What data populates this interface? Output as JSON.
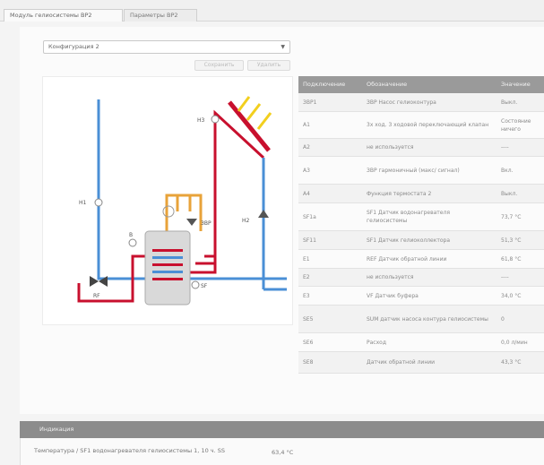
{
  "tabs": [
    {
      "label": "Модуль гелиосистемы BP2"
    },
    {
      "label": "Параметры BP2"
    }
  ],
  "config_select": {
    "value": "Конфигурация 2"
  },
  "buttons": {
    "save": "Сохранить",
    "delete": "Удалить"
  },
  "diagram": {
    "labels": {
      "h3": "H3",
      "h1": "H1",
      "b": "В",
      "h2": "H2",
      "sp": "ЗВР",
      "sf": "SF",
      "rf": "RF"
    },
    "colors": {
      "hot": "#c8102e",
      "cold": "#4a8fd6",
      "dhw": "#e8a33a",
      "sun": "#f2cf1e",
      "tank": "#d9d9d9"
    }
  },
  "table": {
    "headers": [
      "Подключение",
      "Обозначение",
      "Значение"
    ],
    "rows": [
      {
        "port": "ЗВР1",
        "name": "ЗВР Насос гелиоконтура",
        "value": "Выкл."
      },
      {
        "port": "A1",
        "name": "3х ход. 3 ходовой переключающий клапан",
        "value": "Состояние ничего"
      },
      {
        "port": "A2",
        "name": "не используется",
        "value": "----"
      },
      {
        "port": "A3",
        "name": "ЗВР гармоничный (макс/ сигнал)",
        "value": "Вкл."
      },
      {
        "port": "A4",
        "name": "Функция термостата 2",
        "value": "Выкл."
      },
      {
        "port": "SF1a",
        "name": "SF1 Датчик водонагревателя гелиосистемы",
        "value": "73,7 °C"
      },
      {
        "port": "SF11",
        "name": "SF1 Датчик гелиоколлектора",
        "value": "51,3 °C"
      },
      {
        "port": "E1",
        "name": "REF Датчик обратной линии",
        "value": "61,8 °C"
      },
      {
        "port": "E2",
        "name": "не используется",
        "value": "----"
      },
      {
        "port": "E3",
        "name": "VF Датчик буфера",
        "value": "34,0 °C"
      },
      {
        "port": "SE5",
        "name": "SUM датчик насоса контура гелиосистемы",
        "value": "0"
      },
      {
        "port": "SE6",
        "name": "Расход",
        "value": "0,0 л/мин"
      },
      {
        "port": "SE8",
        "name": "Датчик обратной линии",
        "value": "43,3 °C"
      }
    ]
  },
  "indications": {
    "title": "Индикация",
    "label": "Температура / SF1 водонагревателя гелиосистемы 1, 10 ч. SS",
    "value": "63,4 °C"
  }
}
